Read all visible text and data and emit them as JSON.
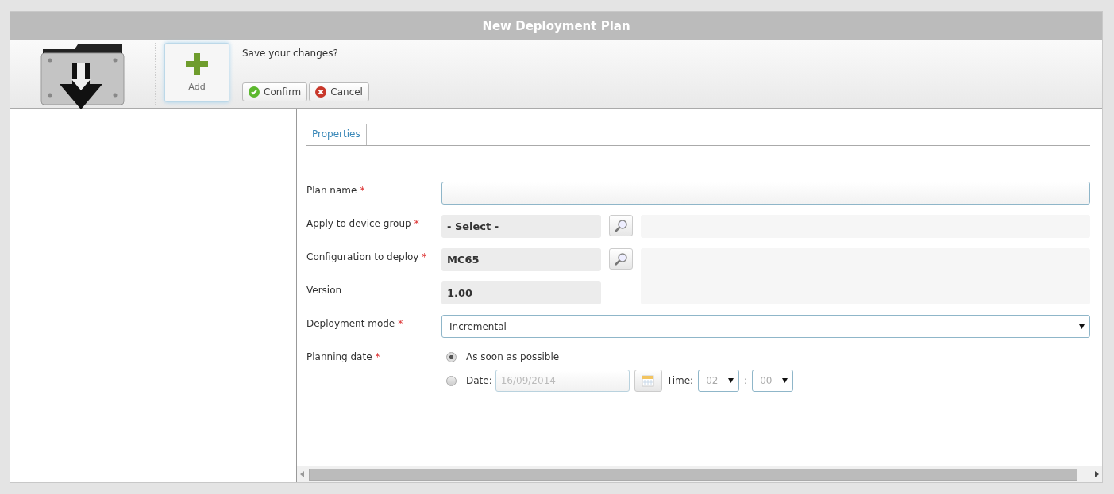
{
  "window": {
    "title": "New Deployment Plan"
  },
  "toolbar": {
    "add_label": "Add",
    "prompt": "Save your changes?",
    "buttons": [
      {
        "label": "Confirm",
        "kind": "confirm"
      },
      {
        "label": "Cancel",
        "kind": "cancel"
      }
    ]
  },
  "tabs": [
    {
      "label": "Properties",
      "selected": true
    }
  ],
  "fields": [
    {
      "kind": "text",
      "label": "Plan name",
      "required_mark": "*"
    },
    {
      "kind": "lookup",
      "label": "Apply to device group",
      "required_mark": "*",
      "value": "- Select -"
    },
    {
      "kind": "lookup",
      "label": "Configuration to deploy",
      "required_mark": "*",
      "value": "MC65"
    },
    {
      "kind": "readonly",
      "label": "Version",
      "value": "1.00"
    },
    {
      "kind": "dropdown",
      "label": "Deployment mode",
      "required_mark": "*",
      "value": "Incremental"
    },
    {
      "kind": "schedule",
      "label": "Planning date",
      "required_mark": "*",
      "options": [
        {
          "label": "As soon as possible",
          "selected": true
        },
        {
          "label": "Date:",
          "selected": false
        }
      ],
      "date": "16/09/2014",
      "time_label": "Time:",
      "hour": "02",
      "separator": ":",
      "minute": "00",
      "disabled": true
    }
  ]
}
